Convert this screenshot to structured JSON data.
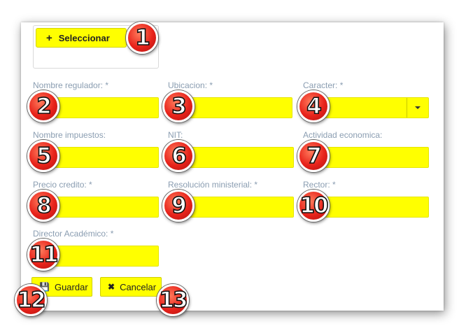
{
  "upload": {
    "select_label": "Seleccionar",
    "plus_icon": "+"
  },
  "fields": [
    {
      "label": "Nombre regulador:",
      "required": "*"
    },
    {
      "label": "Ubicacion:",
      "required": "*"
    },
    {
      "label": "Caracter:",
      "required": "*"
    },
    {
      "label": "Nombre impuestos:",
      "required": ""
    },
    {
      "label": "NIT:",
      "required": ""
    },
    {
      "label": "Actividad economica:",
      "required": ""
    },
    {
      "label": "Precio credito:",
      "required": "*"
    },
    {
      "label": "Resolución ministerial:",
      "required": "*"
    },
    {
      "label": "Rector:",
      "required": "*"
    },
    {
      "label": "Director Académico:",
      "required": "*"
    }
  ],
  "actions": {
    "save_label": "Guardar",
    "save_icon": "💾",
    "cancel_label": "Cancelar",
    "cancel_icon": "✖"
  },
  "badges": [
    "1",
    "2",
    "3",
    "4",
    "5",
    "6",
    "7",
    "8",
    "9",
    "10",
    "11",
    "12",
    "13"
  ],
  "colors": {
    "highlight": "#ffff00",
    "badge": "#e8231b",
    "label": "#8a9db1"
  }
}
